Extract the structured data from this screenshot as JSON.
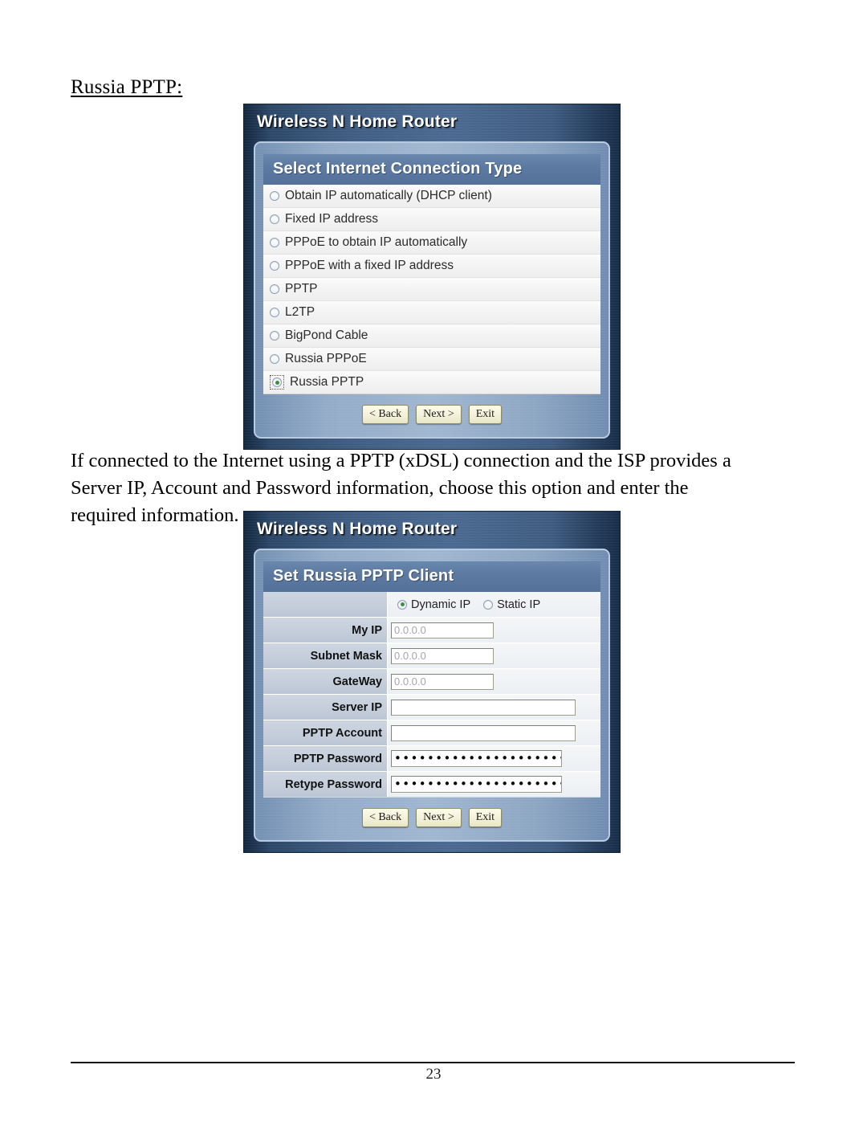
{
  "document": {
    "heading": "Russia PPTP:",
    "paragraph_line_1": "If connected to the Internet using a PPTP (xDSL) connection and the ISP provides a",
    "paragraph_line_2": "Server IP, Account and Password information, choose this option and enter the",
    "paragraph_line_3": "required information.",
    "page_number": "23"
  },
  "screenshot_1": {
    "brand_title": "Wireless N Home Router",
    "section_title": "Select Internet Connection Type",
    "options": [
      {
        "label": "Obtain IP automatically (DHCP client)",
        "selected": false
      },
      {
        "label": "Fixed IP address",
        "selected": false
      },
      {
        "label": "PPPoE to obtain IP automatically",
        "selected": false
      },
      {
        "label": "PPPoE with a fixed IP address",
        "selected": false
      },
      {
        "label": "PPTP",
        "selected": false
      },
      {
        "label": "L2TP",
        "selected": false
      },
      {
        "label": "BigPond Cable",
        "selected": false
      },
      {
        "label": "Russia PPPoE",
        "selected": false
      },
      {
        "label": "Russia PPTP",
        "selected": true
      }
    ],
    "buttons": {
      "back": "< Back",
      "next": "Next >",
      "exit": "Exit"
    }
  },
  "screenshot_2": {
    "brand_title": "Wireless N Home Router",
    "section_title": "Set Russia PPTP Client",
    "ip_type": {
      "label": "",
      "dynamic_label": "Dynamic IP",
      "static_label": "Static IP",
      "selected": "Dynamic IP"
    },
    "fields": [
      {
        "label": "My IP",
        "value": "0.0.0.0",
        "kind": "text-short",
        "muted": true
      },
      {
        "label": "Subnet Mask",
        "value": "0.0.0.0",
        "kind": "text-short",
        "muted": true
      },
      {
        "label": "GateWay",
        "value": "0.0.0.0",
        "kind": "text-short",
        "muted": true
      },
      {
        "label": "Server IP",
        "value": "",
        "kind": "text-long",
        "muted": false
      },
      {
        "label": "PPTP Account",
        "value": "",
        "kind": "text-long",
        "muted": false
      },
      {
        "label": "PPTP Password",
        "value": "••••••••••••••••••••••••",
        "kind": "password",
        "muted": false
      },
      {
        "label": "Retype Password",
        "value": "••••••••••••••••••••••••",
        "kind": "password",
        "muted": false
      }
    ],
    "buttons": {
      "back": "< Back",
      "next": "Next >",
      "exit": "Exit"
    }
  },
  "colors": {
    "frame_dark": "#2a4668",
    "panel_blue": "#94aecb",
    "section_header": "#5b79a1",
    "button_face": "#f3f1d9",
    "radio_selected_dot": "#3f8e3f",
    "label_column": "#c4cdda"
  }
}
